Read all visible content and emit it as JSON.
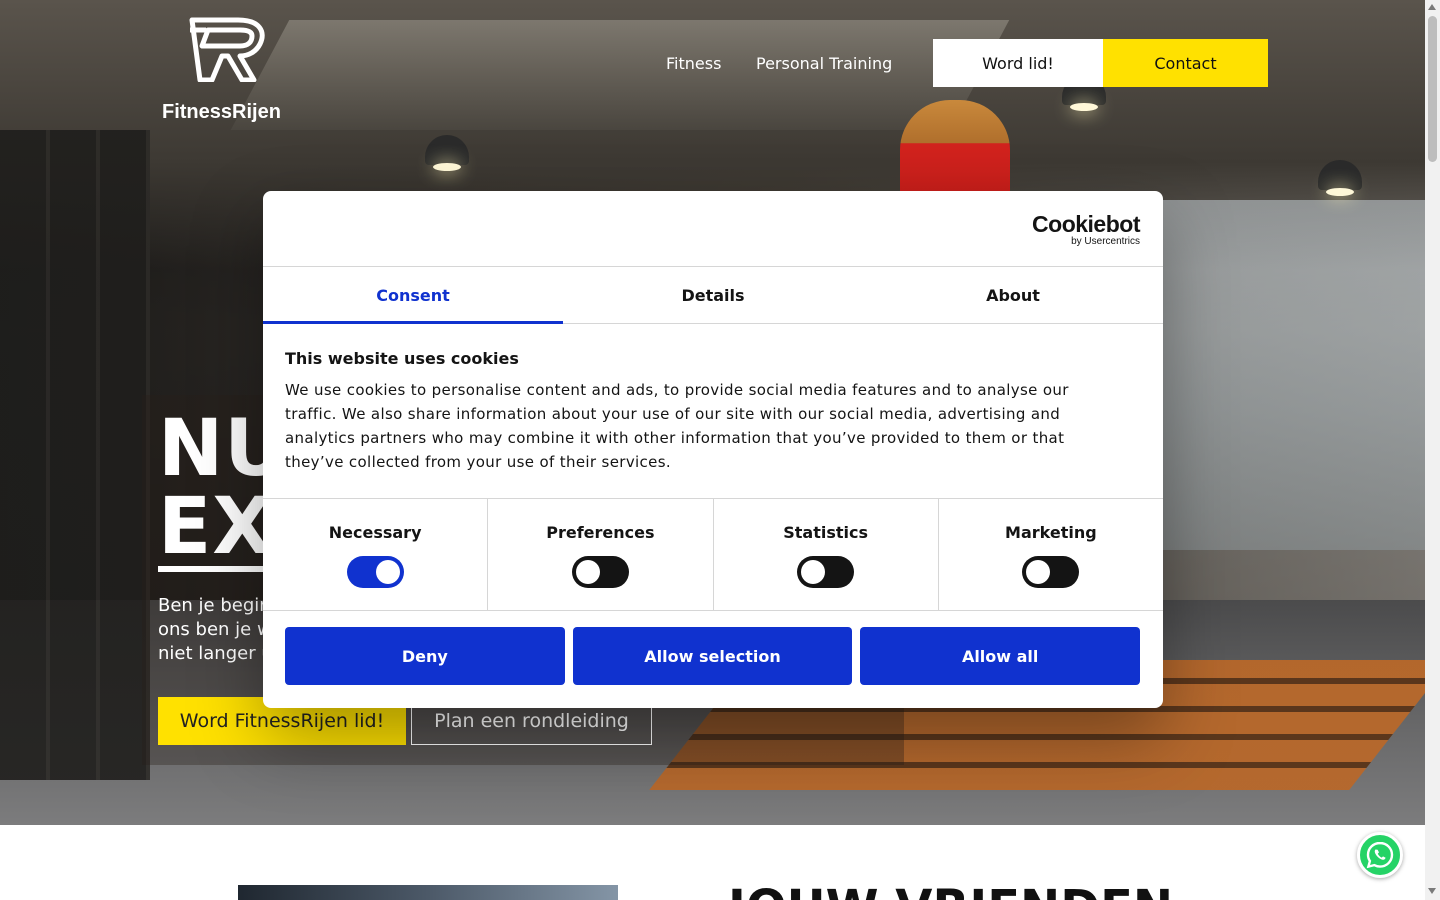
{
  "header": {
    "logo_text": "FitnessRijen",
    "nav": [
      {
        "label": "Fitness"
      },
      {
        "label": "Personal Training"
      }
    ],
    "join_button": "Word lid!",
    "contact_button": "Contact"
  },
  "hero": {
    "title_line1": "NU",
    "title_line2": "EX",
    "subtitle_lines": [
      "Ben je begin",
      "ons ben je w",
      "niet langer u"
    ],
    "cta_primary": "Word FitnessRijen lid!",
    "cta_secondary": "Plan een rondleiding"
  },
  "below": {
    "heading": "JOUW VRIENDEN"
  },
  "cookie_dialog": {
    "brand_main": "Cookiebot",
    "brand_sub": "by Usercentrics",
    "tabs": [
      {
        "label": "Consent",
        "active": true
      },
      {
        "label": "Details",
        "active": false
      },
      {
        "label": "About",
        "active": false
      }
    ],
    "title": "This website uses cookies",
    "text": "We use cookies to personalise content and ads, to provide social media features and to analyse our traffic. We also share information about your use of our site with our social media, advertising and analytics partners who may combine it with other information that you’ve provided to them or that they’ve collected from your use of their services.",
    "toggles": [
      {
        "label": "Necessary",
        "on": true
      },
      {
        "label": "Preferences",
        "on": false
      },
      {
        "label": "Statistics",
        "on": false
      },
      {
        "label": "Marketing",
        "on": false
      }
    ],
    "buttons": {
      "deny": "Deny",
      "allow_selection": "Allow selection",
      "allow_all": "Allow all"
    }
  },
  "colors": {
    "accent_yellow": "#ffe100",
    "cookie_blue": "#1032cf",
    "whatsapp_green": "#25d366"
  },
  "icons": [
    "fitnessrijen-logo-icon",
    "whatsapp-icon"
  ]
}
